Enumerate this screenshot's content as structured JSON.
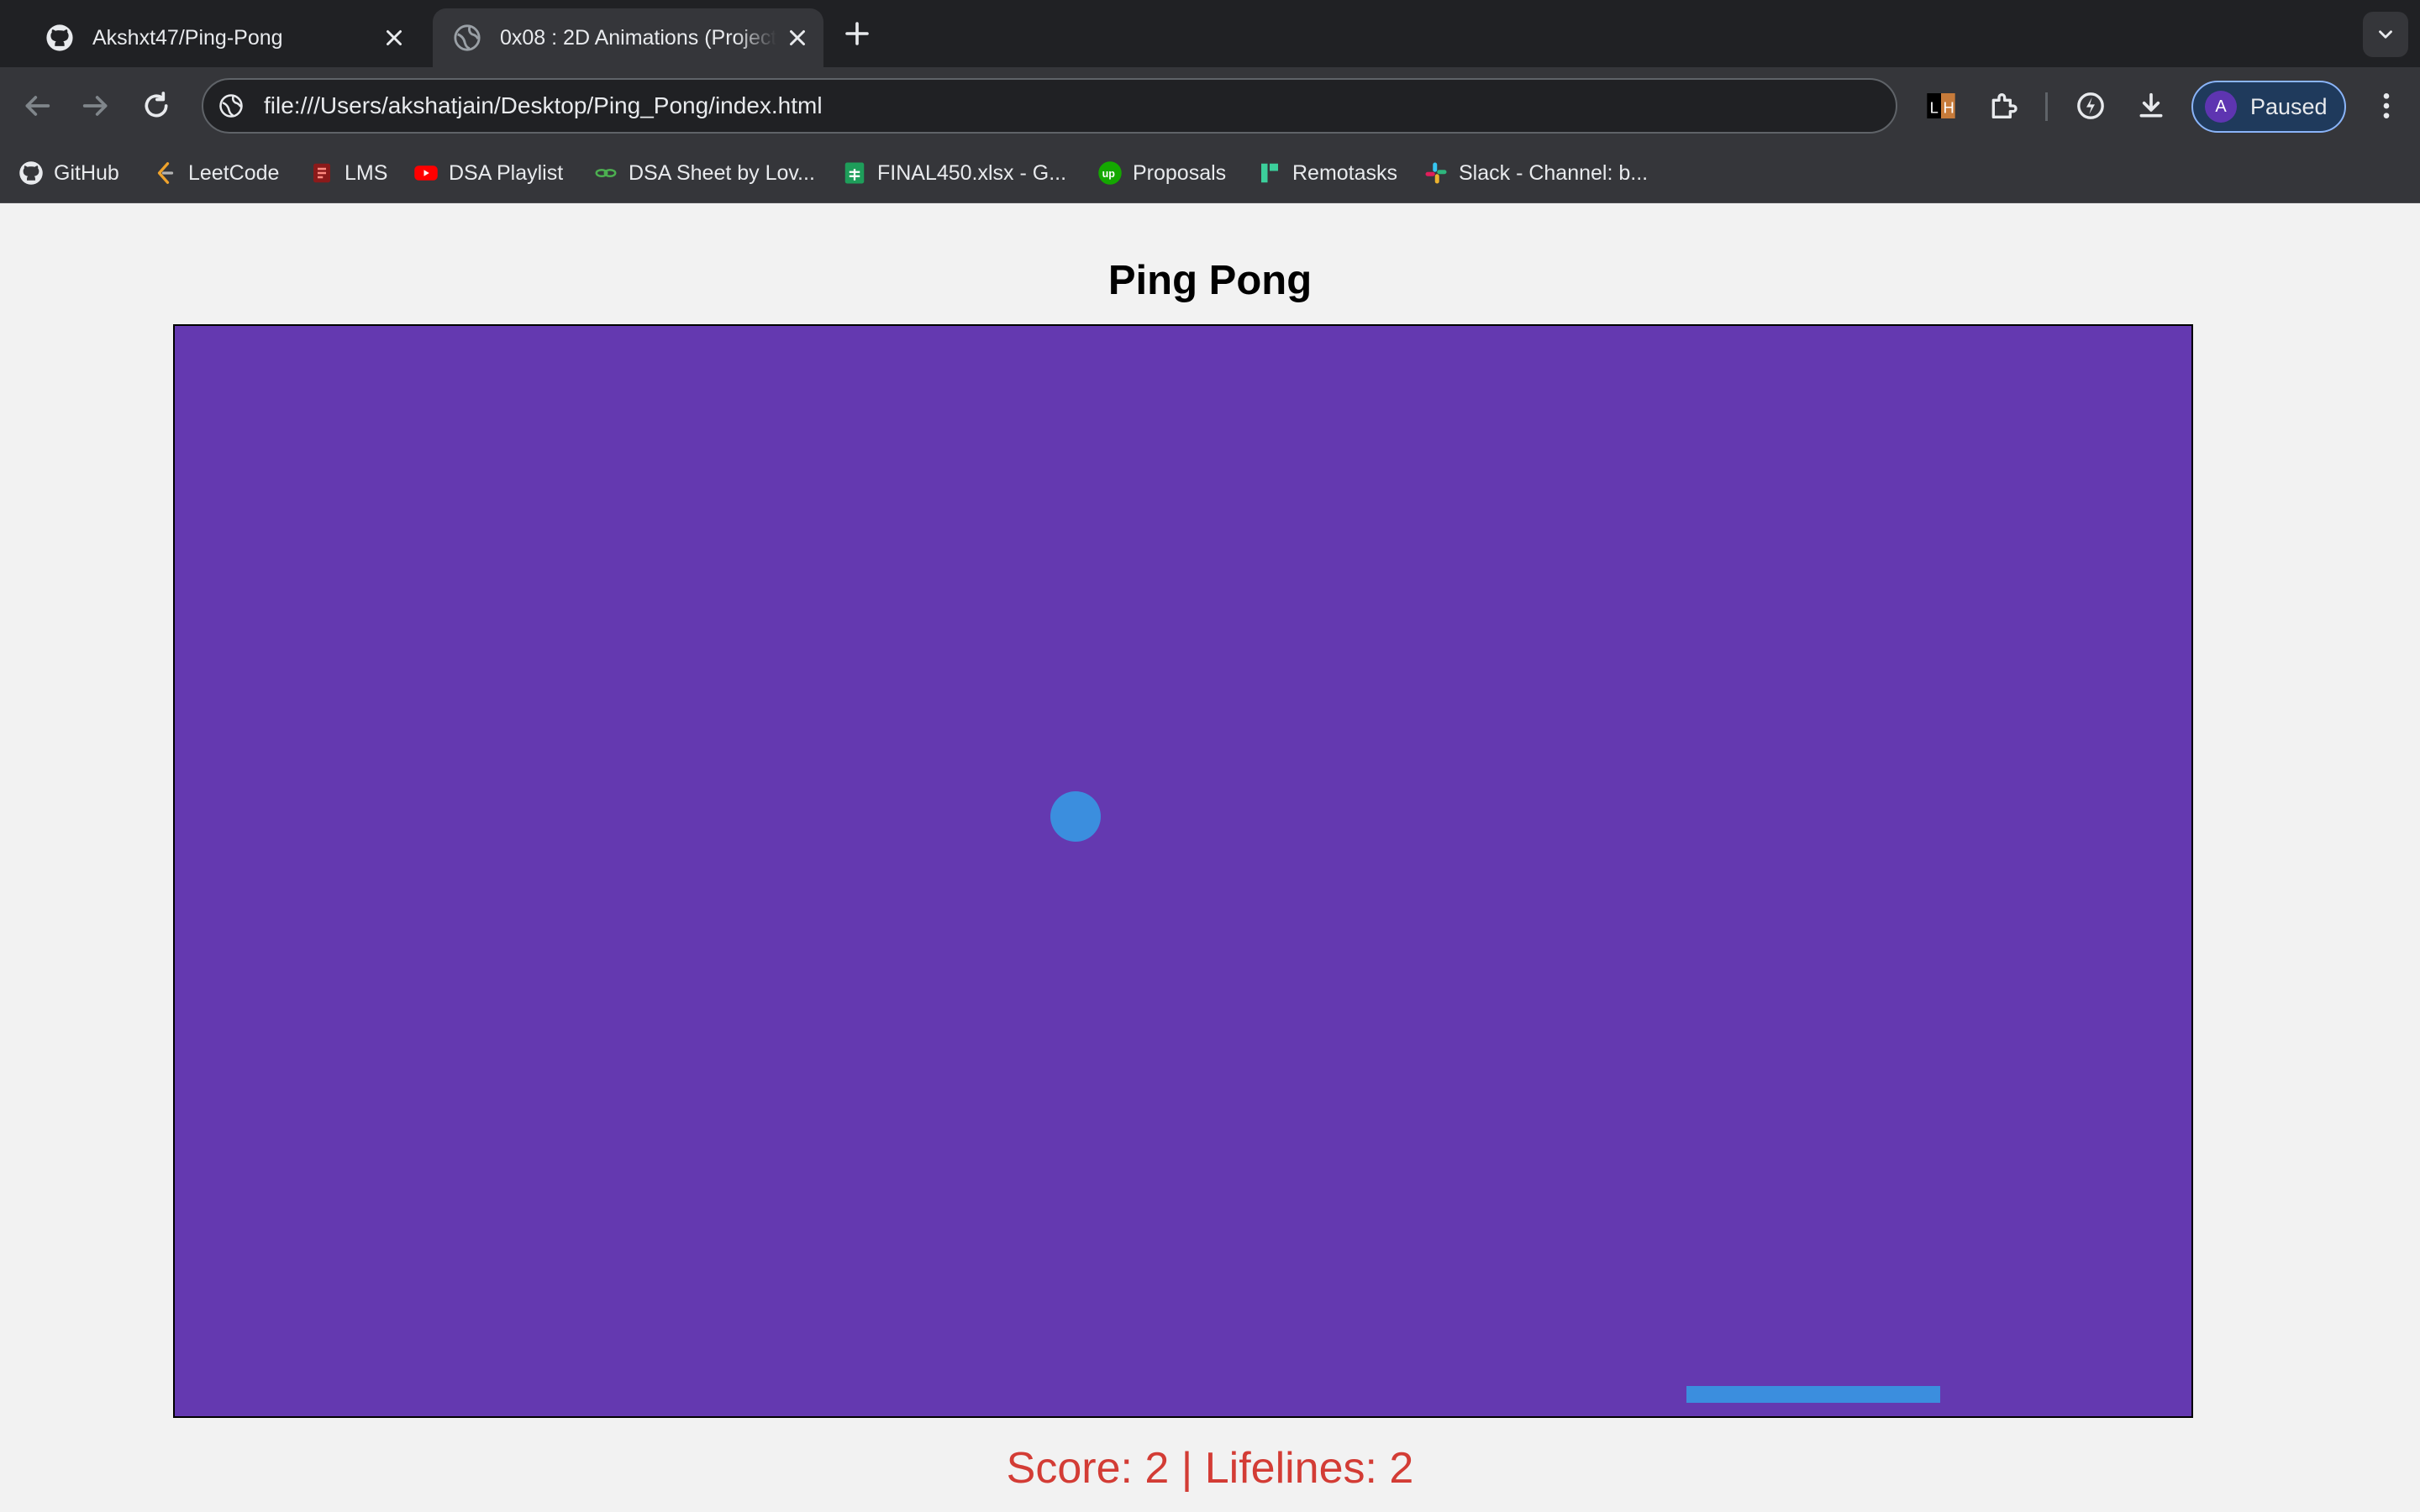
{
  "browser": {
    "tabs": [
      {
        "title": "Akshxt47/Ping-Pong",
        "icon": "github-icon",
        "active": false
      },
      {
        "title": "0x08 : 2D Animations (Project",
        "icon": "globe-icon",
        "active": true
      }
    ],
    "address_bar": {
      "url": "file:///Users/akshatjain/Desktop/Ping_Pong/index.html"
    },
    "profile": {
      "initial": "A",
      "label": "Paused"
    },
    "bookmarks": [
      {
        "label": "GitHub",
        "icon": "github-icon"
      },
      {
        "label": "LeetCode",
        "icon": "leetcode-icon"
      },
      {
        "label": "LMS",
        "icon": "lms-icon"
      },
      {
        "label": "DSA Playlist",
        "icon": "youtube-icon"
      },
      {
        "label": "DSA Sheet by Lov...",
        "icon": "link-icon"
      },
      {
        "label": "FINAL450.xlsx - G...",
        "icon": "sheets-icon"
      },
      {
        "label": "Proposals",
        "icon": "upwork-icon"
      },
      {
        "label": "Remotasks",
        "icon": "remotasks-icon"
      },
      {
        "label": "Slack - Channel: b...",
        "icon": "slack-icon"
      }
    ]
  },
  "page": {
    "title": "Ping Pong",
    "score_text": "Score: 2 | Lifelines: 2"
  },
  "colors": {
    "canvas_background": "#6439b0",
    "ball": "#3b8ede",
    "paddle": "#3b8ede",
    "score_text": "#d33c35"
  }
}
